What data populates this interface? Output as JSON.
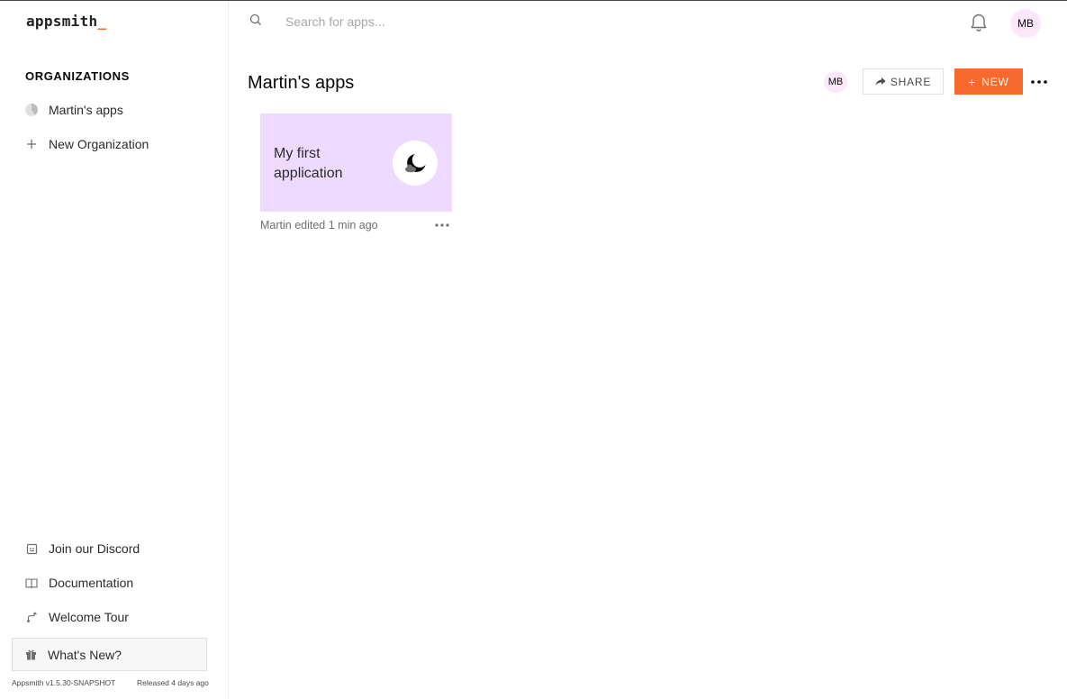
{
  "brand": {
    "logo_text": "appsmith",
    "logo_cursor": "_",
    "accent": "#f86a2b"
  },
  "search": {
    "placeholder": "Search for apps..."
  },
  "user": {
    "initials": "MB"
  },
  "sidebar": {
    "heading": "ORGANIZATIONS",
    "orgs": [
      {
        "label": "Martin's apps"
      }
    ],
    "new_org_label": "New Organization",
    "links": [
      {
        "label": "Join our Discord",
        "icon": "discord-icon"
      },
      {
        "label": "Documentation",
        "icon": "book-icon"
      },
      {
        "label": "Welcome Tour",
        "icon": "tour-icon"
      }
    ],
    "whats_new_label": "What's New?",
    "version": "Appsmith v1.5.30-SNAPSHOT",
    "released": "Released 4 days ago"
  },
  "main": {
    "title": "Martin's apps",
    "member_initials": "MB",
    "share_label": "SHARE",
    "new_label": "NEW",
    "apps": [
      {
        "name": "My first application",
        "edited": "Martin edited 1 min ago",
        "card_color": "#eedaff",
        "icon": "moon-cloud-icon"
      }
    ]
  }
}
